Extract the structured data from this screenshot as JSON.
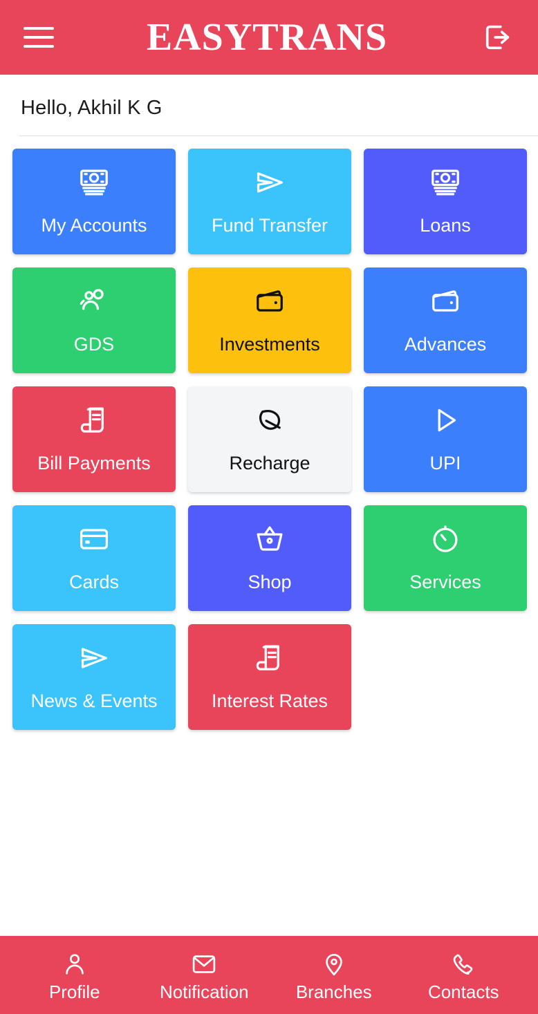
{
  "header": {
    "title": "EASYTRANS",
    "menu_icon": "hamburger-menu-icon",
    "logout_icon": "logout-icon",
    "background_color": "#e8445a"
  },
  "greeting": {
    "text": "Hello, Akhil K G"
  },
  "tiles": [
    {
      "label": "My Accounts",
      "icon": "cash-banknote-icon",
      "bg": "#3b7ffc",
      "fg": "#ffffff"
    },
    {
      "label": "Fund Transfer",
      "icon": "send-plane-icon",
      "bg": "#3bc3fb",
      "fg": "#ffffff"
    },
    {
      "label": "Loans",
      "icon": "cash-banknote-icon",
      "bg": "#515cfb",
      "fg": "#ffffff"
    },
    {
      "label": "GDS",
      "icon": "people-group-icon",
      "bg": "#2ecf71",
      "fg": "#ffffff"
    },
    {
      "label": "Investments",
      "icon": "wallet-icon",
      "bg": "#fcc00d",
      "fg": "#111111"
    },
    {
      "label": "Advances",
      "icon": "wallet-icon",
      "bg": "#3b7ffc",
      "fg": "#ffffff"
    },
    {
      "label": "Bill Payments",
      "icon": "receipt-bill-icon",
      "bg": "#e8445a",
      "fg": "#ffffff"
    },
    {
      "label": "Recharge",
      "icon": "leaf-icon",
      "bg": "#f4f5f7",
      "fg": "#111111"
    },
    {
      "label": "UPI",
      "icon": "play-triangle-icon",
      "bg": "#3b7ffc",
      "fg": "#ffffff"
    },
    {
      "label": "Cards",
      "icon": "credit-card-icon",
      "bg": "#3bc3fb",
      "fg": "#ffffff"
    },
    {
      "label": "Shop",
      "icon": "shopping-basket-icon",
      "bg": "#515cfb",
      "fg": "#ffffff"
    },
    {
      "label": "Services",
      "icon": "stopwatch-icon",
      "bg": "#2ecf71",
      "fg": "#ffffff"
    },
    {
      "label": "News & Events",
      "icon": "send-plane-icon",
      "bg": "#3bc3fb",
      "fg": "#ffffff"
    },
    {
      "label": "Interest Rates",
      "icon": "receipt-bill-icon",
      "bg": "#e8445a",
      "fg": "#ffffff"
    }
  ],
  "bottom_nav": {
    "background_color": "#e8445a",
    "items": [
      {
        "label": "Profile",
        "icon": "person-icon"
      },
      {
        "label": "Notification",
        "icon": "envelope-icon"
      },
      {
        "label": "Branches",
        "icon": "location-pin-icon"
      },
      {
        "label": "Contacts",
        "icon": "phone-icon"
      }
    ]
  }
}
